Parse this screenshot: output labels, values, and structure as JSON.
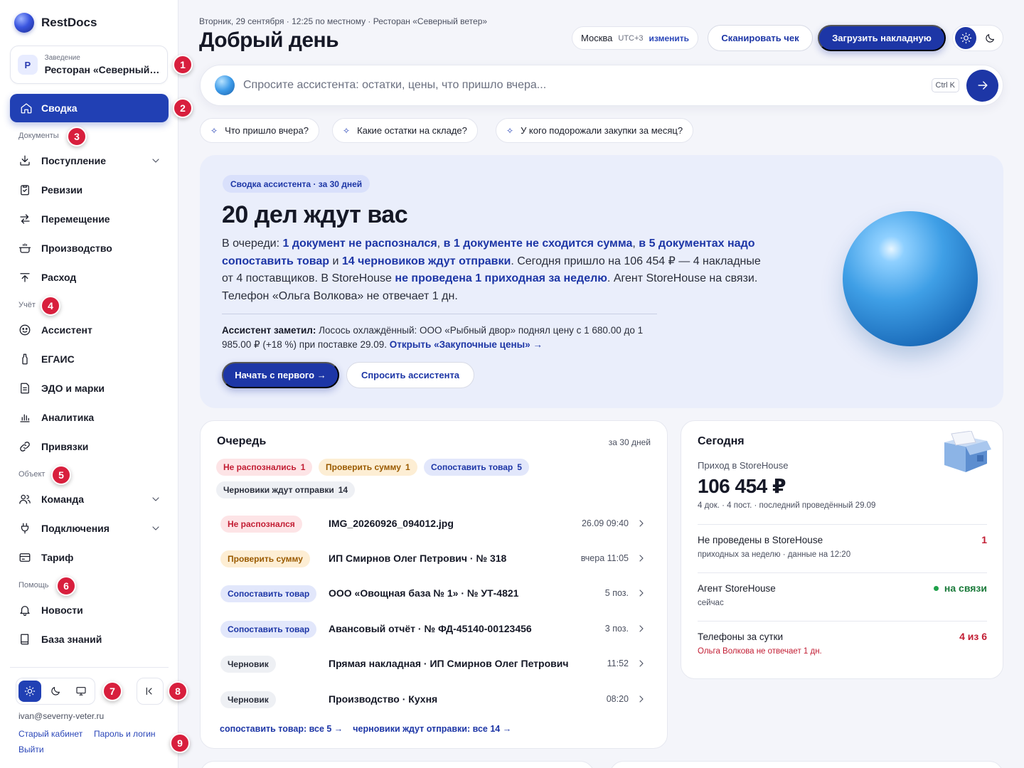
{
  "sidebar": {
    "brand": "RestDocs",
    "venue": {
      "label": "Заведение",
      "avatar": "Р",
      "name": "Ресторан «Северный ветер»"
    },
    "active_item": "Сводка",
    "sections": {
      "documents": "Документы",
      "accounting": "Учёт",
      "object": "Объект",
      "help": "Помощь"
    },
    "documents": [
      {
        "label": "Поступление",
        "icon": "inbox-download-icon",
        "expandable": true
      },
      {
        "label": "Ревизии",
        "icon": "clipboard-icon",
        "expandable": false
      },
      {
        "label": "Перемещение",
        "icon": "transfer-arrows-icon",
        "expandable": false
      },
      {
        "label": "Производство",
        "icon": "pot-icon",
        "expandable": false
      },
      {
        "label": "Расход",
        "icon": "upload-icon",
        "expandable": false
      }
    ],
    "accounting": [
      {
        "label": "Ассистент",
        "icon": "assistant-icon"
      },
      {
        "label": "ЕГАИС",
        "icon": "bottle-icon"
      },
      {
        "label": "ЭДО и марки",
        "icon": "document-icon"
      },
      {
        "label": "Аналитика",
        "icon": "bar-chart-icon"
      },
      {
        "label": "Привязки",
        "icon": "link-icon"
      }
    ],
    "object": [
      {
        "label": "Команда",
        "icon": "team-icon",
        "expandable": true
      },
      {
        "label": "Подключения",
        "icon": "plug-icon",
        "expandable": true
      },
      {
        "label": "Тариф",
        "icon": "card-icon",
        "expandable": false
      }
    ],
    "help": [
      {
        "label": "Новости",
        "icon": "bell-icon"
      },
      {
        "label": "База знаний",
        "icon": "book-icon"
      }
    ],
    "user_email": "ivan@severny-veter.ru",
    "footer_links": {
      "old_cabinet": "Старый кабинет",
      "password": "Пароль и логин",
      "logout": "Выйти"
    }
  },
  "badges": [
    "1",
    "2",
    "3",
    "4",
    "5",
    "6",
    "7",
    "8",
    "9"
  ],
  "header": {
    "date_line": "Вторник, 29 сентября · 12:25 по местному · Ресторан «Северный ветер»",
    "greeting": "Добрый день",
    "tz": {
      "city": "Москва",
      "utc": "UTC+3",
      "change": "изменить"
    },
    "scan_button": "Сканировать чек",
    "upload_button": "Загрузить накладную"
  },
  "ask": {
    "placeholder": "Спросите ассистента: остатки, цены, что пришло вчера...",
    "shortcut": "Ctrl K",
    "chips": [
      "Что пришло вчера?",
      "Какие остатки на складе?",
      "У кого подорожали закупки за месяц?"
    ]
  },
  "hero": {
    "tag": "Сводка ассистента · за 30 дней",
    "title": "20 дел ждут вас",
    "p_intro": "В очереди: ",
    "p_h1": "1 документ не распознался",
    "p_c1": ", ",
    "p_h2": "в 1 документе не сходится сумма",
    "p_c2": ", ",
    "p_h3": "в 5 документах надо сопоставить товар",
    "p_c3": " и ",
    "p_h4": "14 черновиков ждут отправки",
    "p_c4": ". Сегодня пришло на 106 454 ₽ — 4 накладные от 4 поставщиков. В StoreHouse ",
    "p_h5": "не проведена 1 приходная за неделю",
    "p_c5": ". Агент StoreHouse на связи. Телефон «Ольга Волкова» не отвечает 1 дн.",
    "note_bold": "Ассистент заметил:",
    "note_text": " Лосось охлаждённый: ООО «Рыбный двор» поднял цену с 1 680.00 до 1 985.00 ₽ (+18 %) при поставке 29.09. ",
    "note_link": "Открыть «Закупочные цены» →",
    "btn_start": "Начать с первого →",
    "btn_ask": "Спросить ассистента"
  },
  "queue": {
    "title": "Очередь",
    "period": "за 30 дней",
    "filters": [
      {
        "label": "Не распознались",
        "count": "1",
        "tone": "red"
      },
      {
        "label": "Проверить сумму",
        "count": "1",
        "tone": "amber"
      },
      {
        "label": "Сопоставить товар",
        "count": "5",
        "tone": "blue"
      },
      {
        "label": "Черновики ждут отправки",
        "count": "14",
        "tone": "gray"
      }
    ],
    "rows": [
      {
        "status": "Не распознался",
        "tone": "red",
        "name": "IMG_20260926_094012.jpg",
        "meta": "26.09 09:40"
      },
      {
        "status": "Проверить сумму",
        "tone": "amber",
        "name": "ИП Смирнов Олег Петрович · № 318",
        "meta": "вчера 11:05"
      },
      {
        "status": "Сопоставить товар",
        "tone": "blue",
        "name": "ООО «Овощная база № 1» · № УТ-4821",
        "meta": "5 поз."
      },
      {
        "status": "Сопоставить товар",
        "tone": "blue",
        "name": "Авансовый отчёт · № ФД-45140-00123456",
        "meta": "3 поз."
      },
      {
        "status": "Черновик",
        "tone": "gray",
        "name": "Прямая накладная · ИП Смирнов Олег Петрович",
        "meta": "11:52"
      },
      {
        "status": "Черновик",
        "tone": "gray",
        "name": "Производство · Кухня",
        "meta": "08:20"
      }
    ],
    "link_match": "сопоставить товар: все 5 →",
    "link_drafts": "черновики ждут отправки: все 14 →"
  },
  "today": {
    "title": "Сегодня",
    "label": "Приход в StoreHouse",
    "amount": "106 454 ₽",
    "meta": "4 док. · 4 пост. · последний проведённый 29.09",
    "rows": [
      {
        "title": "Не проведены в StoreHouse",
        "sub": "приходных за неделю · данные на 12:20",
        "value": "1"
      },
      {
        "title": "Агент StoreHouse",
        "sub": "сейчас",
        "value": "на связи"
      },
      {
        "title": "Телефоны за сутки",
        "sub": "Ольга Волкова не отвечает 1 дн.",
        "value": "4 из 6"
      }
    ]
  },
  "colors": {
    "accent": "#1d36a6",
    "danger": "#c21d33",
    "success": "#1fa14a",
    "badge": "#d81f3d"
  }
}
